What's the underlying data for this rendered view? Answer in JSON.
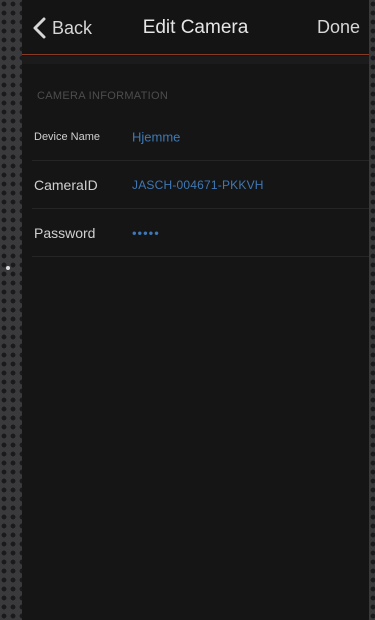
{
  "nav": {
    "back_label": "Back",
    "title": "Edit Camera",
    "done_label": "Done"
  },
  "section": {
    "header": "CAMERA INFORMATION"
  },
  "fields": [
    {
      "label": "Device Name",
      "value": "Hjemme"
    },
    {
      "label": "CameraID",
      "value": "JASCH-004671-PKKVH"
    },
    {
      "label": "Password",
      "value": "•••••"
    }
  ],
  "colors": {
    "accent_value": "#3f78b4",
    "nav_rule": "#8a3a22",
    "background": "#151515"
  },
  "icons": {
    "back": "chevron-left-icon"
  }
}
